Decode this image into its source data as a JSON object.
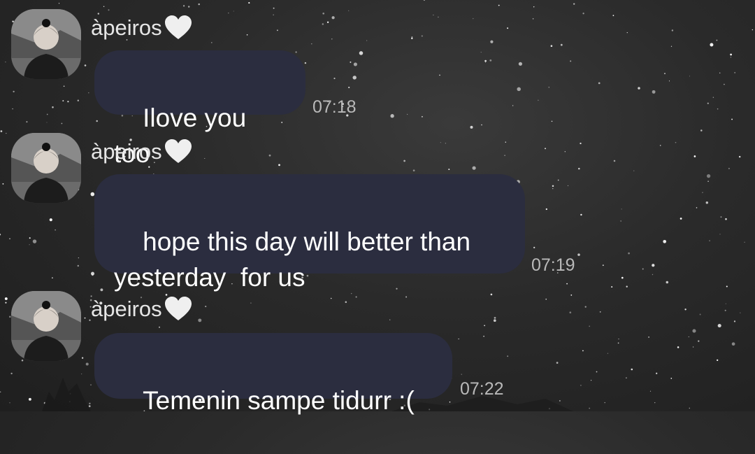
{
  "chat": {
    "messages": [
      {
        "sender": "àpeiros",
        "sender_badge": "white-heart-icon",
        "text": "Ilove you too",
        "time": "07:18"
      },
      {
        "sender": "àpeiros",
        "sender_badge": "white-heart-icon",
        "text": "hope this day will better than\nyesterday  for us",
        "time": "07:19"
      },
      {
        "sender": "àpeiros",
        "sender_badge": "white-heart-icon",
        "text": "Temenin sampe tidurr :(",
        "time": "07:22"
      }
    ]
  },
  "theme": {
    "bubble_color": "#2b2d3f",
    "text_color": "#ffffff",
    "timestamp_color": "#b9b9b9",
    "background": "starry-night-sky"
  }
}
